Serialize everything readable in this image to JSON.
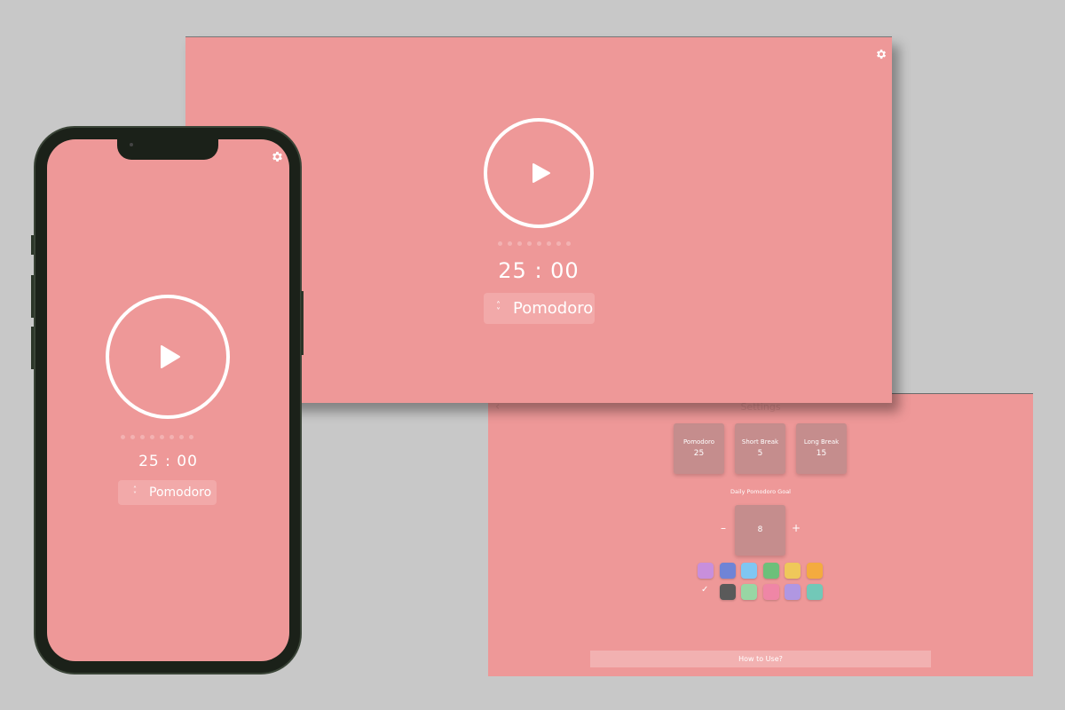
{
  "settings": {
    "title": "Settings",
    "back_icon": "chevron-left-icon",
    "durations": [
      {
        "label": "Pomodoro",
        "value": "25"
      },
      {
        "label": "Short Break",
        "value": "5"
      },
      {
        "label": "Long Break",
        "value": "15"
      }
    ],
    "goal_label": "Daily Pomodoro Goal",
    "goal_value": "8",
    "minus_label": "–",
    "plus_label": "+",
    "colors_row1": [
      "#c88fdc",
      "#6f84d6",
      "#7fc6f2",
      "#6cc07a",
      "#efc85a",
      "#f4ab3f"
    ],
    "colors_row2": [
      "#eb9696",
      "#5a5a5a",
      "#98d6a4",
      "#ef86a6",
      "#b097e2",
      "#72c8b8"
    ],
    "selected_color_index": 0,
    "check_mark": "✓",
    "how_to_label": "How to Use?"
  },
  "desktop": {
    "time": "25 : 00",
    "mode_label": "Pomodoro",
    "session_dot_count": 8,
    "gear_icon": "gear-icon",
    "play_icon": "play-icon"
  },
  "phone": {
    "time": "25 : 00",
    "mode_label": "Pomodoro",
    "session_dot_count": 8
  },
  "colors": {
    "background": "#c8c8c8",
    "panel": "#ee9898",
    "card": "#c58d8d",
    "button": "#f2a9a9",
    "dot": "#f3b2b2",
    "phone_frame": "#1b2119"
  }
}
